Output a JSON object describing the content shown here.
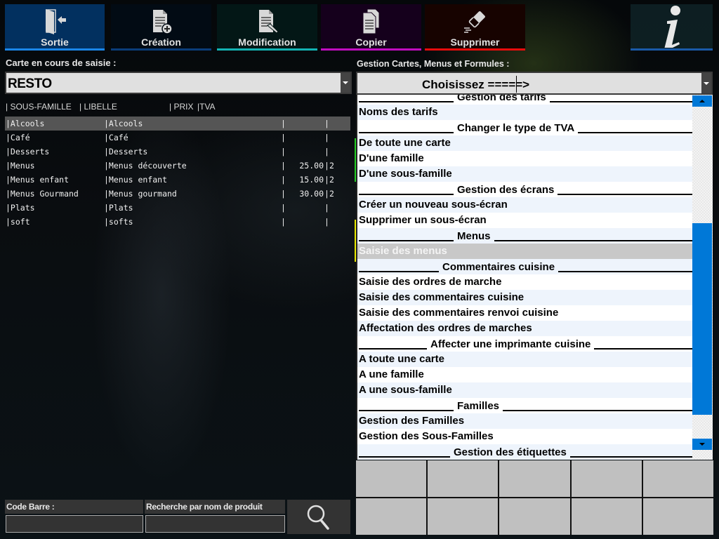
{
  "toolbar": {
    "buttons": [
      {
        "id": "sortie",
        "label": "Sortie",
        "icon": "exit-door-icon",
        "accent": "#1b86e8"
      },
      {
        "id": "creation",
        "label": "Création",
        "icon": "document-add-icon",
        "accent": "#0a3d7a"
      },
      {
        "id": "modification",
        "label": "Modification",
        "icon": "document-edit-icon",
        "accent": "#13b4b4"
      },
      {
        "id": "copier",
        "label": "Copier",
        "icon": "copy-icon",
        "accent": "#c20cc2"
      },
      {
        "id": "supprimer",
        "label": "Supprimer",
        "icon": "eraser-icon",
        "accent": "#e80c0c"
      },
      {
        "id": "info",
        "label": "",
        "icon": "info-icon",
        "accent": "#1a5aa8"
      }
    ]
  },
  "left": {
    "carte_label": "Carte en cours de saisie :",
    "carte_value": "RESTO",
    "columns": {
      "sous_famille": "| SOUS-FAMILLE",
      "libelle": "| LIBELLE",
      "prix": "| PRIX",
      "tva": "|TVA"
    },
    "rows": [
      {
        "sous_famille": "|Alcools",
        "libelle": "|Alcools",
        "prix": "",
        "tva": "",
        "selected": true
      },
      {
        "sous_famille": "|Café",
        "libelle": "|Café",
        "prix": "",
        "tva": ""
      },
      {
        "sous_famille": "|Desserts",
        "libelle": "|Desserts",
        "prix": "",
        "tva": ""
      },
      {
        "sous_famille": "|Menus",
        "libelle": "|Menus découverte",
        "prix": "25.00",
        "tva": "2"
      },
      {
        "sous_famille": "|Menus enfant",
        "libelle": "|Menus enfant",
        "prix": "15.00",
        "tva": "2"
      },
      {
        "sous_famille": "|Menus Gourmand",
        "libelle": "|Menus gourmand",
        "prix": "30.00",
        "tva": "2"
      },
      {
        "sous_famille": "|Plats",
        "libelle": "|Plats",
        "prix": "",
        "tva": ""
      },
      {
        "sous_famille": "|soft",
        "libelle": "|softs",
        "prix": "",
        "tva": ""
      }
    ],
    "barcode_label": "Code Barre :",
    "barcode_value": "",
    "product_search_label": "Recherche par nom de produit",
    "product_search_value": "",
    "search_icon": "search-icon"
  },
  "right": {
    "gestion_label": "Gestion Cartes, Menus et Formules  :",
    "gestion_value": "Choisissez  =====>",
    "menu_items": [
      {
        "type": "header",
        "label": "Gestion des tarifs",
        "cut": true
      },
      {
        "type": "item",
        "label": "Noms des tarifs"
      },
      {
        "type": "header",
        "label": "Changer le type de TVA"
      },
      {
        "type": "item",
        "label": "De toute une carte"
      },
      {
        "type": "item",
        "label": "D'une famille"
      },
      {
        "type": "item",
        "label": "D'une sous-famille"
      },
      {
        "type": "header",
        "label": "Gestion des écrans"
      },
      {
        "type": "item",
        "label": "Créer un nouveau sous-écran"
      },
      {
        "type": "item",
        "label": "Supprimer un sous-écran"
      },
      {
        "type": "header",
        "label": "Menus"
      },
      {
        "type": "item",
        "label": "Saisie des menus",
        "selected": true
      },
      {
        "type": "header",
        "label": "Commentaires cuisine"
      },
      {
        "type": "item",
        "label": "Saisie des ordres de marche"
      },
      {
        "type": "item",
        "label": "Saisie des commentaires cuisine"
      },
      {
        "type": "item",
        "label": "Saisie des commentaires renvoi cuisine"
      },
      {
        "type": "item",
        "label": "Affectation des ordres de marches"
      },
      {
        "type": "header",
        "label": "Affecter une imprimante cuisine"
      },
      {
        "type": "item",
        "label": "A toute une carte"
      },
      {
        "type": "item",
        "label": "A une famille"
      },
      {
        "type": "item",
        "label": "A une sous-famille"
      },
      {
        "type": "header",
        "label": "Familles"
      },
      {
        "type": "item",
        "label": "Gestion des Familles"
      },
      {
        "type": "item",
        "label": "Gestion des Sous-Familles"
      },
      {
        "type": "header",
        "label": "Gestion des étiquettes"
      }
    ],
    "scroll_position_fraction": 0.42,
    "colors": {
      "scroll_accent": "#0078d7",
      "selected_row": "#c8c8c8",
      "side_green": "#22cc22",
      "side_yellow": "#e8e800"
    }
  },
  "button_grid": {
    "count": 10,
    "labels": [
      "",
      "",
      "",
      "",
      "",
      "",
      "",
      "",
      "",
      ""
    ]
  }
}
